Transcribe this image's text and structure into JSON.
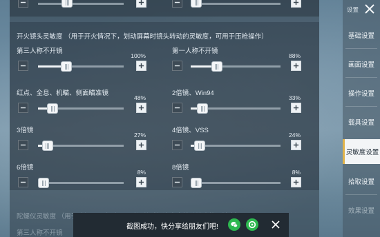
{
  "section": {
    "title": "开火镜头灵敏度 （用于开火情况下，划动屏幕时镜头转动的灵敏度，可用于压枪操作）",
    "next_title": "陀螺仪灵敏度 （用于陀螺仪开启时，通过调整手机姿态来转动镜头的灵敏度）",
    "next_first_label": "第三人称不开镜"
  },
  "sliders": [
    {
      "label": "第三人称不开镜",
      "value": "100%",
      "fraction": 0.3
    },
    {
      "label": "第一人称不开镜",
      "value": "88%",
      "fraction": 0.26
    },
    {
      "label": "红点、全息、机瞄、侧面瞄准镜",
      "value": "48%",
      "fraction": 0.14
    },
    {
      "label": "2倍镜、Win94",
      "value": "33%",
      "fraction": 0.1
    },
    {
      "label": "3倍镜",
      "value": "27%",
      "fraction": 0.08
    },
    {
      "label": "4倍镜、VSS",
      "value": "24%",
      "fraction": 0.07
    },
    {
      "label": "6倍镜",
      "value": "8%",
      "fraction": 0.02
    },
    {
      "label": "8倍镜",
      "value": "8%",
      "fraction": 0.02
    }
  ],
  "sidebar": {
    "header": "设置",
    "items": [
      {
        "label": "基础设置"
      },
      {
        "label": "画面设置"
      },
      {
        "label": "操作设置"
      },
      {
        "label": "载具设置"
      },
      {
        "label": "灵敏度设置"
      },
      {
        "label": "拾取设置"
      },
      {
        "label": "效果设置"
      }
    ]
  },
  "toast": {
    "message": "截图成功，快分享给朋友们吧!"
  }
}
